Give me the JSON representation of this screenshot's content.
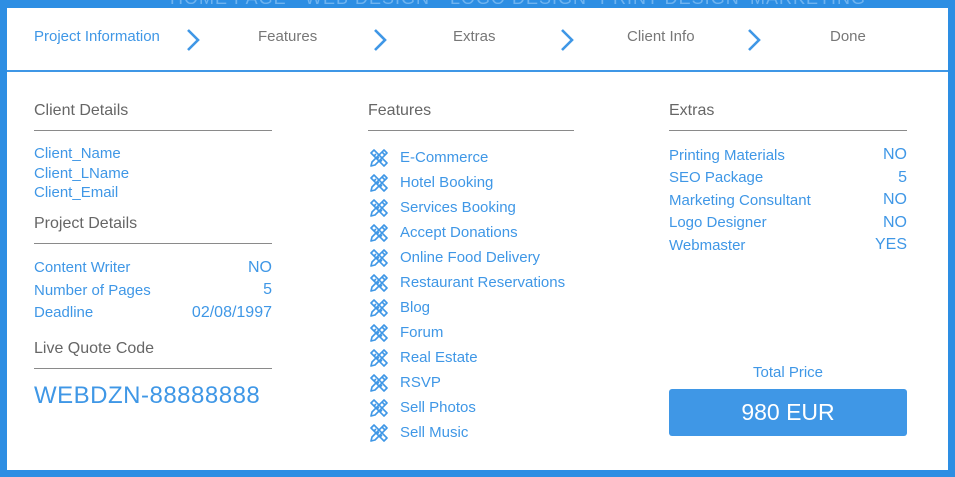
{
  "background_nav": [
    "HOME PAGE",
    "WEB DESIGN",
    "LOGO DESIGN",
    "PRINT DESIGN",
    "MARKETING"
  ],
  "steps": [
    "Project Information",
    "Features",
    "Extras",
    "Client Info",
    "Done"
  ],
  "client_details": {
    "title": "Client Details",
    "name": "Client_Name",
    "lname": "Client_LName",
    "email": "Client_Email"
  },
  "project_details": {
    "title": "Project Details",
    "rows": [
      {
        "label": "Content Writer",
        "value": "NO"
      },
      {
        "label": "Number of Pages",
        "value": "5"
      },
      {
        "label": "Deadline",
        "value": "02/08/1997"
      }
    ]
  },
  "live_quote": {
    "title": "Live Quote Code",
    "code": "WEBDZN-88888888"
  },
  "features": {
    "title": "Features",
    "items": [
      "E-Commerce",
      "Hotel Booking",
      "Services Booking",
      "Accept Donations",
      "Online Food Delivery",
      "Restaurant Reservations",
      "Blog",
      "Forum",
      "Real Estate",
      "RSVP",
      "Sell Photos",
      "Sell Music"
    ]
  },
  "extras": {
    "title": "Extras",
    "rows": [
      {
        "label": "Printing Materials",
        "value": "NO"
      },
      {
        "label": "SEO Package",
        "value": "5"
      },
      {
        "label": "Marketing Consultant",
        "value": "NO"
      },
      {
        "label": "Logo Designer",
        "value": "NO"
      },
      {
        "label": "Webmaster",
        "value": "YES"
      }
    ]
  },
  "total": {
    "label": "Total Price",
    "value": "980 EUR"
  },
  "colors": {
    "accent": "#3f97e6",
    "background": "#2d8ee3",
    "muted_text": "#666666"
  },
  "icons": {
    "step_separator": "chevron-right-icon",
    "feature": "pencil-ruler-icon"
  }
}
